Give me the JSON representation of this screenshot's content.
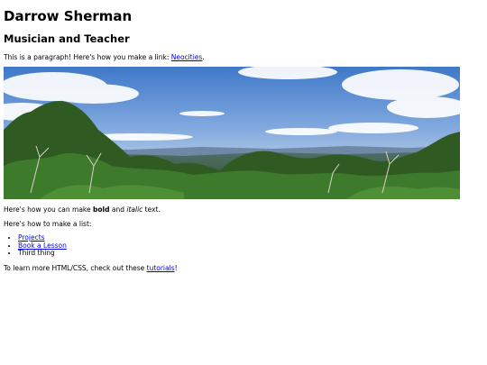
{
  "header": {
    "name": "Darrow Sherman",
    "subtitle": "Musician and Teacher"
  },
  "intro": {
    "text_before_link": "This is a paragraph! Here's how you make a link: ",
    "link_label": "Neocities",
    "text_after_link": "."
  },
  "formatting": {
    "prefix": "Here's how you can make ",
    "bold_word": "bold",
    "middle": " and ",
    "italic_word": "italic",
    "suffix": " text."
  },
  "list_intro": "Here's how to make a list:",
  "list": {
    "items": [
      {
        "label": "Projects",
        "is_link": true
      },
      {
        "label": "Book a Lesson",
        "is_link": true
      },
      {
        "label": "Third thing",
        "is_link": false
      }
    ]
  },
  "outro": {
    "text_before_link": "To learn more HTML/CSS, check out these ",
    "link_label": "tutorials",
    "text_after_link": "!"
  },
  "colors": {
    "link": "#0000ee",
    "text": "#000000",
    "background": "#ffffff"
  }
}
